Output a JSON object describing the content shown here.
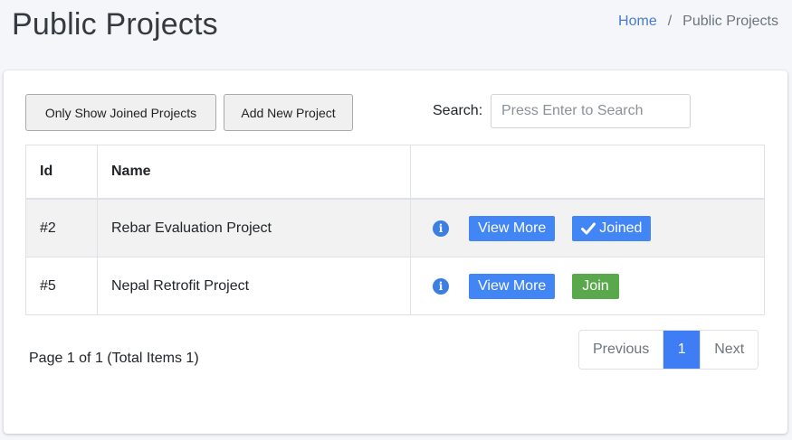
{
  "page": {
    "title": "Public Projects"
  },
  "breadcrumb": {
    "home": "Home",
    "separator": "/",
    "current": "Public Projects"
  },
  "toolbar": {
    "only_joined_label": "Only Show Joined Projects",
    "add_project_label": "Add New Project",
    "search_label": "Search:",
    "search_placeholder": "Press Enter to Search",
    "search_value": ""
  },
  "table": {
    "headers": {
      "id": "Id",
      "name": "Name",
      "actions": ""
    },
    "rows": [
      {
        "id": "#2",
        "name": "Rebar Evaluation Project",
        "view_label": "View More",
        "join_label": "Joined",
        "joined": true
      },
      {
        "id": "#5",
        "name": "Nepal Retrofit Project",
        "view_label": "View More",
        "join_label": "Join",
        "joined": false
      }
    ]
  },
  "footer": {
    "page_info": "Page 1 of 1 (Total Items 1)",
    "prev_label": "Previous",
    "current_page": "1",
    "next_label": "Next"
  },
  "colors": {
    "primary": "#4285f4",
    "success": "#5aa84c",
    "link": "#4a7bd0",
    "active_page": "#3f7df5"
  },
  "icons": {
    "info": "info-circle-icon",
    "check": "check-icon"
  }
}
